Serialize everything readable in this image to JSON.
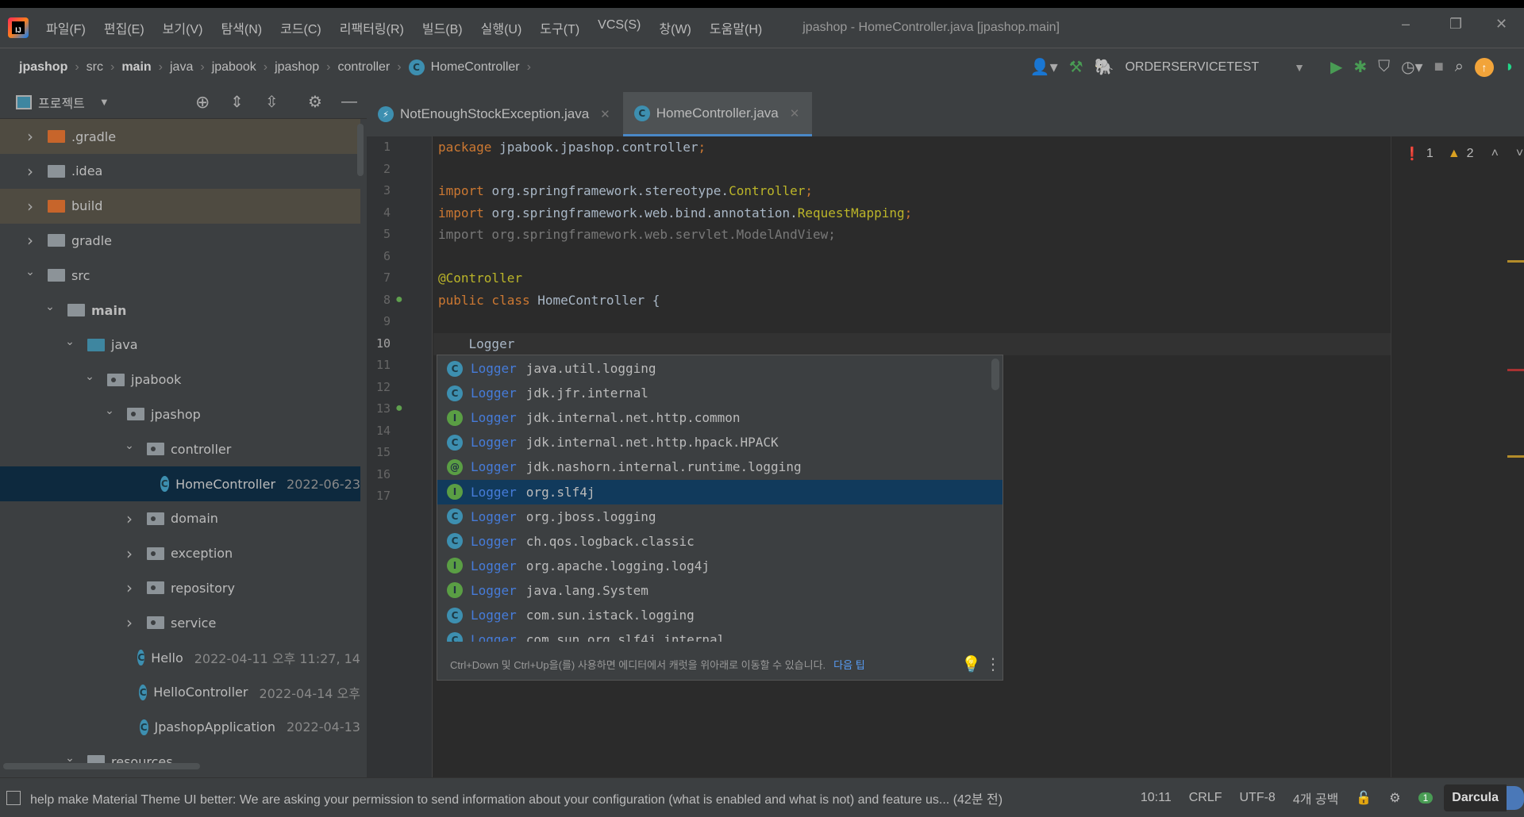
{
  "window": {
    "title": "jpashop - HomeController.java [jpashop.main]"
  },
  "menu": [
    "파일(F)",
    "편집(E)",
    "보기(V)",
    "탐색(N)",
    "코드(C)",
    "리팩터링(R)",
    "빌드(B)",
    "실행(U)",
    "도구(T)",
    "VCS(S)",
    "창(W)",
    "도움말(H)"
  ],
  "breadcrumb": [
    "jpashop",
    "src",
    "main",
    "java",
    "jpabook",
    "jpashop",
    "controller",
    "HomeController"
  ],
  "toolbar": {
    "run_config": "ORDERSERVICETEST"
  },
  "project": {
    "title": "프로젝트",
    "tree": [
      {
        "label": ".gradle",
        "depth": 0,
        "state": "collapsed",
        "kind": "orange",
        "ignored": true
      },
      {
        "label": ".idea",
        "depth": 0,
        "state": "collapsed",
        "kind": "gray"
      },
      {
        "label": "build",
        "depth": 0,
        "state": "collapsed",
        "kind": "orange",
        "ignored": true
      },
      {
        "label": "gradle",
        "depth": 0,
        "state": "collapsed",
        "kind": "gray"
      },
      {
        "label": "src",
        "depth": 0,
        "state": "expanded",
        "kind": "gray"
      },
      {
        "label": "main",
        "depth": 1,
        "state": "expanded",
        "kind": "gray",
        "bold": true
      },
      {
        "label": "java",
        "depth": 2,
        "state": "expanded",
        "kind": "blue"
      },
      {
        "label": "jpabook",
        "depth": 3,
        "state": "expanded",
        "kind": "pkg"
      },
      {
        "label": "jpashop",
        "depth": 4,
        "state": "expanded",
        "kind": "pkg"
      },
      {
        "label": "controller",
        "depth": 5,
        "state": "expanded",
        "kind": "pkg"
      },
      {
        "label": "HomeController",
        "date": "2022-06-23",
        "depth": 6,
        "state": "none",
        "kind": "class",
        "selected": true
      },
      {
        "label": "domain",
        "depth": 5,
        "state": "collapsed",
        "kind": "pkg"
      },
      {
        "label": "exception",
        "depth": 5,
        "state": "collapsed",
        "kind": "pkg"
      },
      {
        "label": "repository",
        "depth": 5,
        "state": "collapsed",
        "kind": "pkg"
      },
      {
        "label": "service",
        "depth": 5,
        "state": "collapsed",
        "kind": "pkg"
      },
      {
        "label": "Hello",
        "date": "2022-04-11 오후 11:27, 14",
        "depth": 5,
        "state": "none",
        "kind": "class"
      },
      {
        "label": "HelloController",
        "date": "2022-04-14 오후",
        "depth": 5,
        "state": "none",
        "kind": "class"
      },
      {
        "label": "JpashopApplication",
        "date": "2022-04-13",
        "depth": 5,
        "state": "none",
        "kind": "class"
      },
      {
        "label": "resources",
        "depth": 2,
        "state": "expanded",
        "kind": "gray"
      }
    ]
  },
  "tabs": [
    {
      "label": "NotEnoughStockException.java",
      "icon": "exception-icon"
    },
    {
      "label": "HomeController.java",
      "icon": "class-icon",
      "active": true
    }
  ],
  "editor": {
    "current_line": 10,
    "lines": [
      [
        [
          "kw",
          "package "
        ],
        [
          "",
          "jpabook.jpashop.controller"
        ],
        [
          "kw",
          ";"
        ]
      ],
      [],
      [
        [
          "kw",
          "import "
        ],
        [
          "",
          "org.springframework.stereotype."
        ],
        [
          "cls",
          "Controller"
        ],
        [
          "kw",
          ";"
        ]
      ],
      [
        [
          "kw",
          "import "
        ],
        [
          "",
          "org.springframework.web.bind.annotation."
        ],
        [
          "cls",
          "RequestMapping"
        ],
        [
          "kw",
          ";"
        ]
      ],
      [
        [
          "gray",
          "import org.springframework.web.servlet.ModelAndView;"
        ]
      ],
      [],
      [
        [
          "ann",
          "@Controller"
        ]
      ],
      [
        [
          "kw",
          "public class "
        ],
        [
          "",
          "HomeController {"
        ]
      ],
      [],
      [
        [
          "",
          "    Logger"
        ]
      ],
      [],
      [],
      [],
      [],
      [],
      [],
      []
    ],
    "inspections": {
      "errors": "1",
      "warnings": "2"
    }
  },
  "completion": {
    "items": [
      {
        "name": "Logger",
        "pkg": "java.util.logging",
        "kind": "C"
      },
      {
        "name": "Logger",
        "pkg": "jdk.jfr.internal",
        "kind": "C"
      },
      {
        "name": "Logger",
        "pkg": "jdk.internal.net.http.common",
        "kind": "I"
      },
      {
        "name": "Logger",
        "pkg": "jdk.internal.net.http.hpack.HPACK",
        "kind": "C"
      },
      {
        "name": "Logger",
        "pkg": "jdk.nashorn.internal.runtime.logging",
        "kind": "@"
      },
      {
        "name": "Logger",
        "pkg": "org.slf4j",
        "kind": "I",
        "selected": true
      },
      {
        "name": "Logger",
        "pkg": "org.jboss.logging",
        "kind": "C"
      },
      {
        "name": "Logger",
        "pkg": "ch.qos.logback.classic",
        "kind": "C"
      },
      {
        "name": "Logger",
        "pkg": "org.apache.logging.log4j",
        "kind": "I"
      },
      {
        "name": "Logger",
        "pkg": "java.lang.System",
        "kind": "I"
      },
      {
        "name": "Logger",
        "pkg": "com.sun.istack.logging",
        "kind": "C"
      },
      {
        "name": "Logger",
        "pkg": "com.sun.org.slf4j.internal",
        "kind": "C"
      }
    ],
    "tip": "Ctrl+Down 및 Ctrl+Up을(를) 사용하면 에디터에서 캐럿을 위아래로 이동할 수 있습니다.",
    "next_tip": "다음 팁"
  },
  "status": {
    "message": "help make Material Theme UI better: We are asking your permission to send information about your configuration (what is enabled and what is not) and feature us... (42분 전)",
    "position": "10:11",
    "line_sep": "CRLF",
    "encoding": "UTF-8",
    "indent": "4개 공백",
    "notifications": "1",
    "theme": "Darcula"
  },
  "colors": {
    "accent": "#4a88c7",
    "selection": "#113a5c",
    "keyword": "#cc7832",
    "annotation": "#bbb529"
  }
}
